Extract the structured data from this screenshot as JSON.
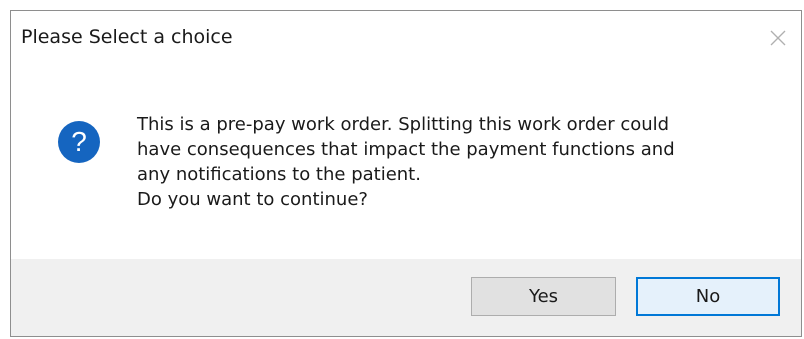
{
  "dialog": {
    "title": "Please Select a choice",
    "close_icon": "close-icon",
    "message_icon": "question-icon",
    "message_lines": [
      "This is a pre-pay work order. Splitting this work order could",
      "have consequences that impact the payment functions and",
      "any notifications to the patient.",
      "Do you want to continue?"
    ],
    "buttons": {
      "yes_label": "Yes",
      "no_label": "No",
      "default": "No"
    }
  },
  "colors": {
    "question_icon_fill": "#1565c0",
    "default_button_border": "#0078d7",
    "footer_background": "#f0f0f0"
  }
}
